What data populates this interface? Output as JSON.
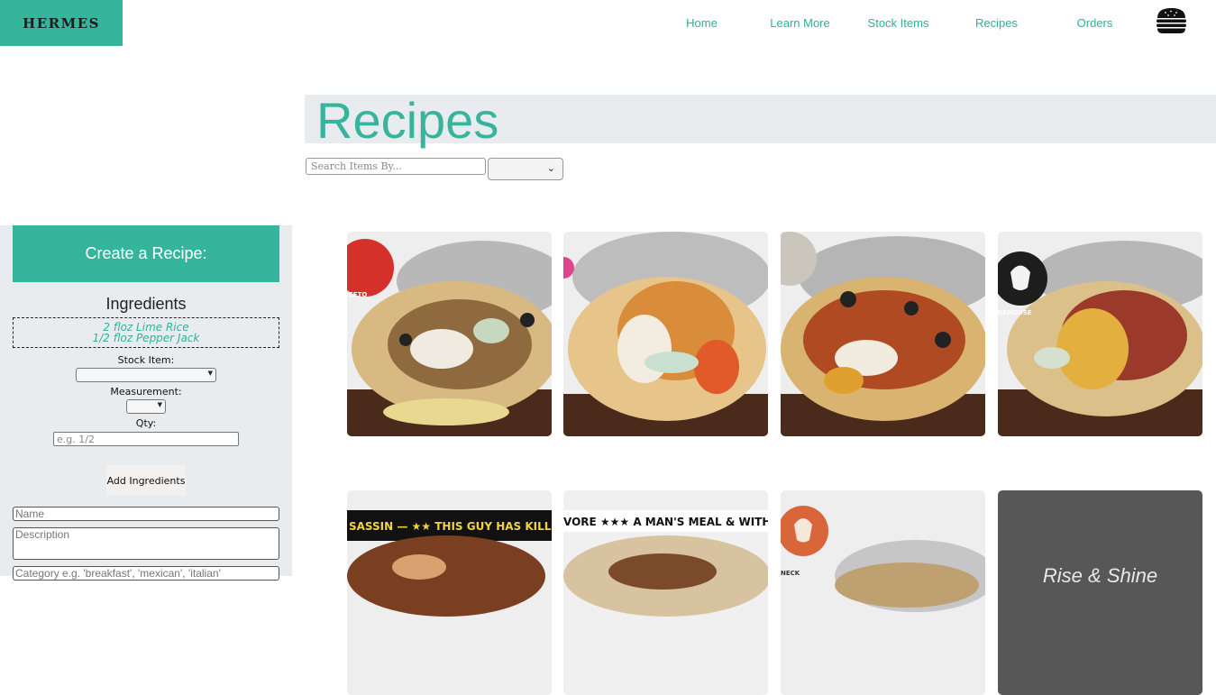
{
  "header": {
    "logo_text": "HERMES",
    "nav": [
      "Home",
      "Learn More",
      "Stock Items",
      "Recipes",
      "Orders"
    ],
    "burger_icon": "burger-icon"
  },
  "page": {
    "title": "Recipes",
    "search_placeholder": "Search Items By...",
    "filter_value": ""
  },
  "sidebar": {
    "heading": "Create a Recipe:",
    "ingredients_title": "Ingredients",
    "ingredients": [
      "2 floz Lime Rice",
      "1/2 floz Pepper Jack"
    ],
    "stock_item_label": "Stock Item:",
    "measurement_label": "Measurement:",
    "qty_label": "Qty:",
    "qty_placeholder": "e.g. 1/2",
    "add_button": "Add Ingredients",
    "name_placeholder": "Name",
    "description_placeholder": "Description",
    "category_placeholder": "Category e.g. 'breakfast', 'mexican', 'italian'"
  },
  "cards_row1": [
    {
      "badge_text": "EETO",
      "badge_color": "#d6302b"
    },
    {
      "badge_text": "",
      "badge_color": "#e0448e"
    },
    {
      "badge_text": "",
      "badge_color": "#b8b3aa"
    },
    {
      "badge_text": "KEHOUSE",
      "badge_color": "#1d1d1d"
    }
  ],
  "cards_row2": [
    {
      "banner_text": "SASSIN — ★★ THIS GUY HAS KILL",
      "banner_color": "#111111"
    },
    {
      "banner_text": "VORE ★★★ A MAN'S MEAL & WITH A SRI",
      "banner_color": "#ffffff"
    },
    {
      "badge_text": "NECK",
      "badge_color": "#d8663a"
    },
    {
      "title": "Rise & Shine"
    }
  ],
  "colors": {
    "accent": "#35b59c",
    "panel": "#e8ecef"
  }
}
